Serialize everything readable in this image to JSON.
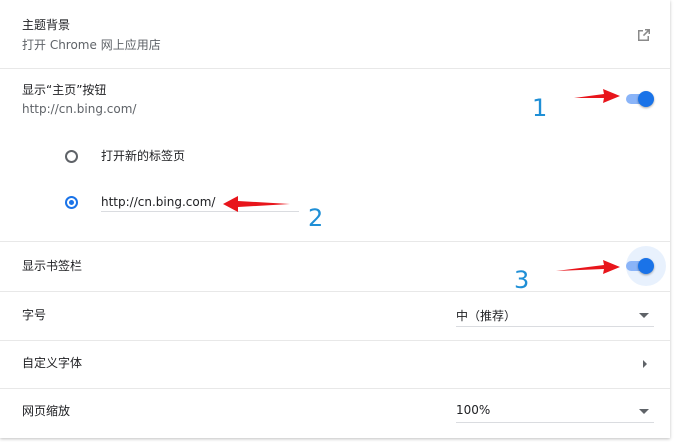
{
  "theme": {
    "title": "主题背景",
    "subtitle": "打开 Chrome 网上应用店"
  },
  "home_button": {
    "title": "显示“主页”按钮",
    "url": "http://cn.bing.com/",
    "enabled": true,
    "options": [
      {
        "label": "打开新的标签页",
        "checked": false
      },
      {
        "value": "http://cn.bing.com/",
        "checked": true
      }
    ]
  },
  "bookmarks_bar": {
    "label": "显示书签栏",
    "enabled": true
  },
  "font_size": {
    "label": "字号",
    "value": "中（推荐）"
  },
  "custom_fonts": {
    "label": "自定义字体"
  },
  "page_zoom": {
    "label": "网页缩放",
    "value": "100%"
  },
  "annotations": {
    "one": "1",
    "two": "2",
    "three": "3"
  },
  "colors": {
    "accent": "#1a73e8",
    "track": "#8ab4f8",
    "annotation_arrow": "#e8151b",
    "annotation_number": "#1f8fd6"
  }
}
